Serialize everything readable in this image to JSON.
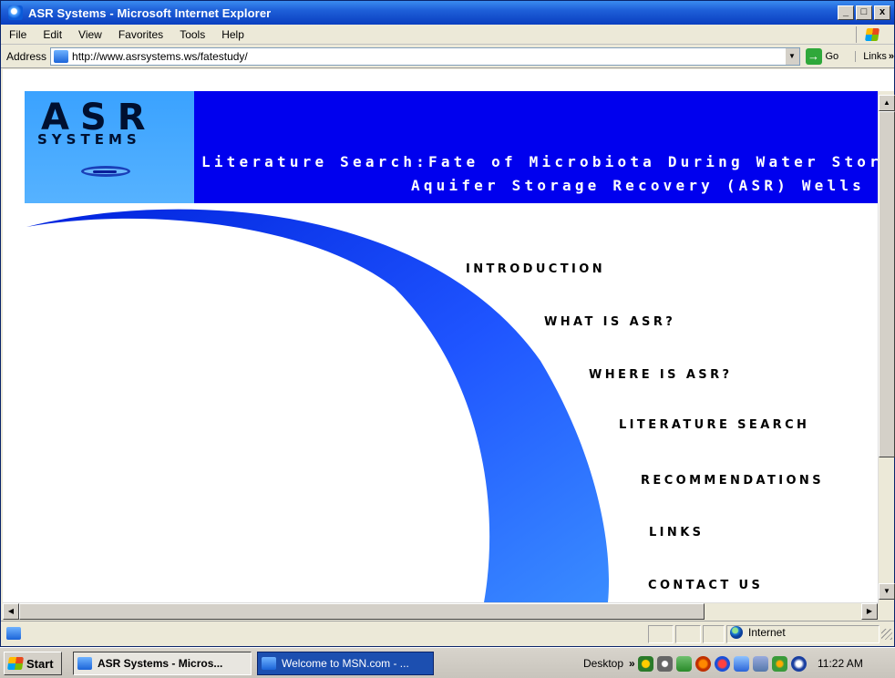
{
  "window": {
    "title": "ASR Systems - Microsoft Internet Explorer",
    "minimize": "_",
    "maximize": "□",
    "close": "x"
  },
  "menu": {
    "items": [
      "File",
      "Edit",
      "View",
      "Favorites",
      "Tools",
      "Help"
    ]
  },
  "address": {
    "label": "Address",
    "url": "http://www.asrsystems.ws/fatestudy/",
    "go_label": "Go",
    "links_label": "Links",
    "links_chevron": "»"
  },
  "page": {
    "logo_top": "ASR",
    "logo_bottom": "SYSTEMS",
    "banner_line1": "Literature Search:Fate of Microbiota During Water Storage",
    "banner_line2": "Aquifer Storage Recovery (ASR) Wells",
    "nav": [
      "INTRODUCTION",
      "WHAT IS ASR?",
      "WHERE IS ASR?",
      "LITERATURE SEARCH",
      "RECOMMENDATIONS",
      "LINKS",
      "CONTACT US"
    ],
    "colors": {
      "banner": "#0000ee",
      "logo_bg": "#3aa2ff",
      "arc": "#1a4fff"
    }
  },
  "status": {
    "zone": "Internet"
  },
  "taskbar": {
    "start": "Start",
    "tasks": [
      "ASR Systems - Micros...",
      "Welcome to MSN.com - ..."
    ],
    "desktop": "Desktop",
    "chevron": "»",
    "clock": "11:22 AM"
  }
}
